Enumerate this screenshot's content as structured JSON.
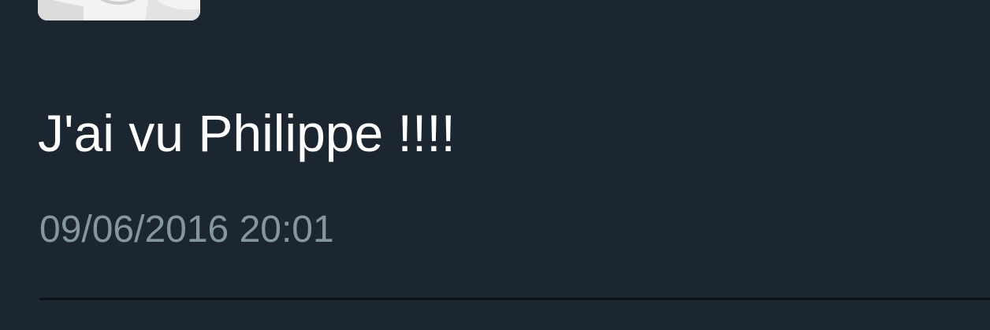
{
  "tweet": {
    "text": "J'ai vu Philippe !!!!",
    "timestamp": "09/06/2016 20:01"
  },
  "colors": {
    "background": "#1c2630",
    "text": "#ffffff",
    "timestamp": "#8596a3",
    "divider": "#0c1218"
  }
}
